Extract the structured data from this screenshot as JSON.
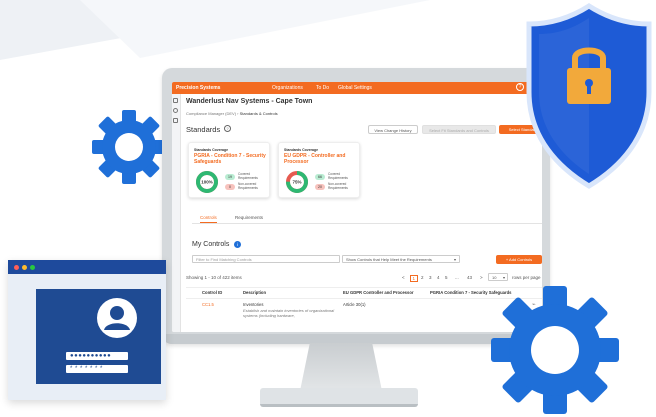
{
  "app": {
    "brand": "Precision Systems",
    "nav": [
      "Organizations",
      "To Do",
      "Global Settings"
    ],
    "org_title": "Wanderlust Nav Systems - Cape Town",
    "breadcrumb": [
      "Compliance Manager (DEV)",
      "Standards & Controls"
    ],
    "section_title": "Standards",
    "buttons": {
      "view_history": "View Change History",
      "select_fit": "Select Fit Standards and Controls",
      "select_standard": "Select Standard"
    },
    "coverage_cards": [
      {
        "label": "Standards Coverage",
        "title": "PGRIA - Condition 7 - Security Safeguards",
        "percent": "100%",
        "covered_count": "19",
        "covered_label": "Covered Requirements",
        "noncovered_count": "0",
        "noncovered_label": "Non-covered Requirements",
        "covered_fraction": 1.0
      },
      {
        "label": "Standards Coverage",
        "title": "EU GDPR - Controller and Processor",
        "percent": "75%",
        "covered_count": "66",
        "covered_label": "Covered Requirements",
        "noncovered_count": "20",
        "noncovered_label": "Non-covered Requirements",
        "covered_fraction": 0.75
      }
    ],
    "tabs": [
      "Controls",
      "Requirements"
    ],
    "controls": {
      "title": "My Controls",
      "filter_placeholder": "Filter to Find Matching Controls",
      "show_dropdown": "Show Controls that Help Meet the Requirements",
      "add_button": "+ Add Controls",
      "showing": "Showing 1 - 10 of 422 items",
      "pages": [
        "<",
        "1",
        "2",
        "3",
        "4",
        "5",
        "...",
        "43",
        ">"
      ],
      "per_page": "10",
      "per_page_label": "rows per page",
      "columns": [
        "Control ID",
        "Description",
        "EU GDPR Controller and Processor",
        "PGRIA Condition 7 - Security Safeguards"
      ],
      "rows": [
        {
          "id": "CC1.5",
          "desc_title": "Inventories",
          "desc_text": "Establish and maintain inventories of organizational systems (including hardware,",
          "gdpr": "Article 30(1)",
          "pgria": ""
        }
      ]
    }
  },
  "login": {
    "password": "●●●●●●●●●●",
    "pin": "* * * * * * *"
  },
  "colors": {
    "brand_orange": "#f36b21",
    "primary_blue": "#1f6fd8",
    "shield_blue": "#1e5bd6",
    "lock_yellow": "#f2a93b",
    "donut_green": "#2eb872",
    "donut_red": "#e65a50"
  }
}
